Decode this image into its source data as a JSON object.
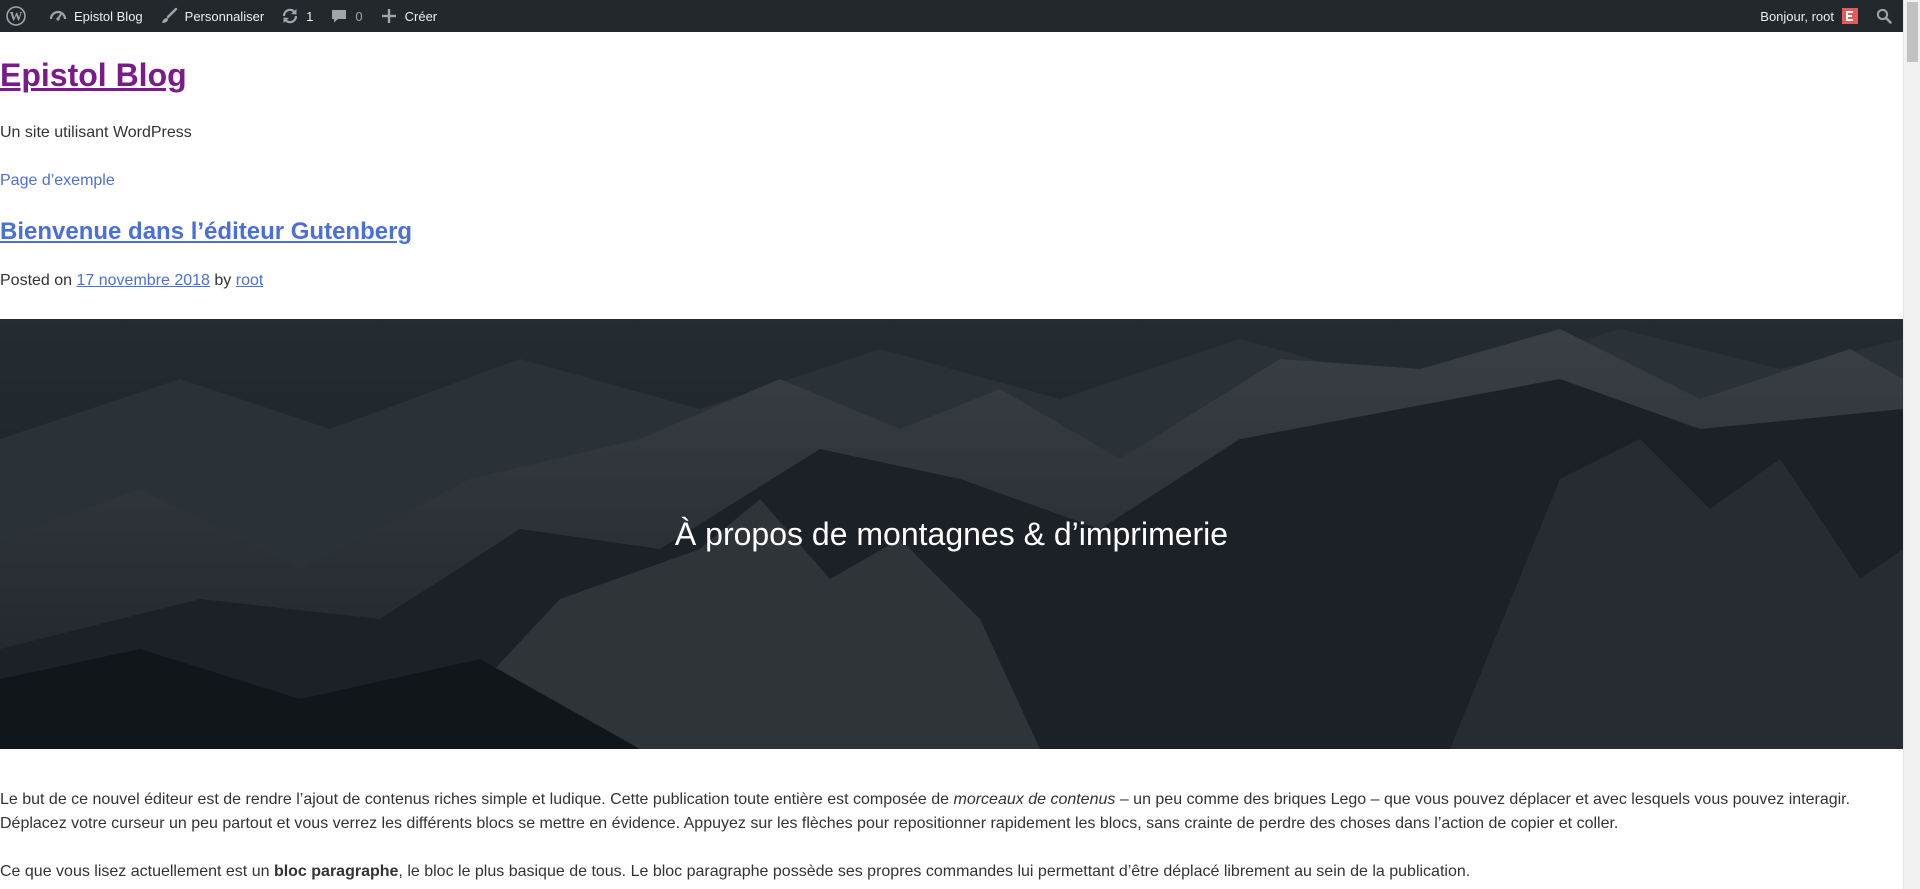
{
  "adminbar": {
    "wp_logo": "wordpress-icon",
    "site_name": "Epistol Blog",
    "customize": "Personnaliser",
    "updates_count": "1",
    "comments_count": "0",
    "new_label": "Créer",
    "greeting": "Bonjour, root",
    "background_color": "#23282d"
  },
  "site": {
    "title": "Epistol Blog",
    "tagline": "Un site utilisant WordPress",
    "menu": [
      "Page d’exemple"
    ]
  },
  "post": {
    "title": "Bienvenue dans l’éditeur Gutenberg",
    "meta_prefix": "Posted on",
    "date": "17 novembre 2018",
    "meta_by": "by",
    "author": "root",
    "cover_title": "À propos de montagnes & d’imprimerie",
    "para1": {
      "part1": "Le but de ce nouvel éditeur est de rendre l’ajout de contenus riches simple et ludique. Cette publication toute entière est composée de ",
      "emphasis": "morceaux de contenus",
      "part2": " – un peu comme des briques Lego – que vous pouvez déplacer et avec lesquels vous pouvez interagir. Déplacez votre curseur un peu partout et vous verrez les différents blocs se mettre en évidence. Appuyez sur les flèches pour repositionner rapidement les blocs, sans crainte de perdre des choses dans l’action de copier et coller."
    },
    "para2": {
      "part1": "Ce que vous lisez actuellement est un ",
      "bold": "bloc paragraphe",
      "part2": ", le bloc le plus basique de tous. Le bloc paragraphe possède ses propres commandes lui permettant d’être déplacé librement au sein de la publication."
    }
  },
  "colors": {
    "site_title": "#7b1a8b",
    "link": "#4a6fd8",
    "text": "#333333"
  }
}
